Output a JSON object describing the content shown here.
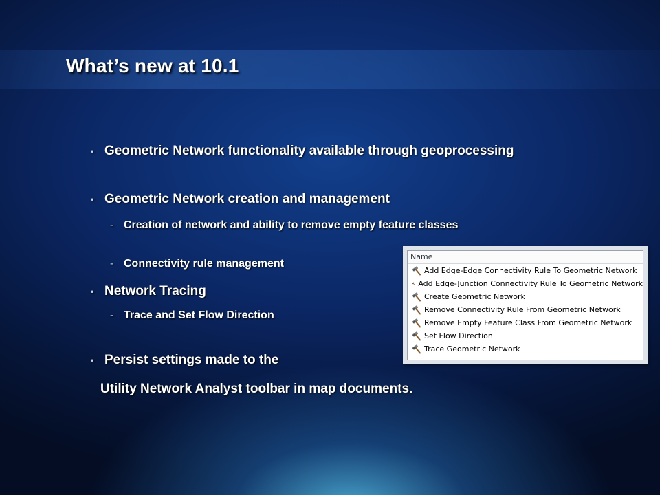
{
  "slide": {
    "title": "What’s new at 10.1",
    "bullets": [
      {
        "text": "Geometric Network functionality available through geoprocessing",
        "level": 1
      },
      {
        "text": "Geometric Network creation and management",
        "level": 1
      },
      {
        "text": "Creation of network and ability to remove empty feature classes",
        "level": 2
      },
      {
        "text": "Connectivity rule management",
        "level": 2
      },
      {
        "text": "Network Tracing",
        "level": 1
      },
      {
        "text": "Trace and Set Flow Direction",
        "level": 2
      },
      {
        "text": "Persist settings made to the",
        "level": 1
      }
    ],
    "continuation": "Utility Network Analyst toolbar in map documents."
  },
  "toolbox": {
    "header": "Name",
    "icon": "hammer-icon",
    "tools": [
      "Add Edge-Edge Connectivity Rule To Geometric Network",
      "Add Edge-Junction Connectivity Rule To Geometric Network",
      "Create Geometric Network",
      "Remove Connectivity Rule From Geometric Network",
      "Remove Empty Feature Class From Geometric Network",
      "Set Flow Direction",
      "Trace Geometric Network"
    ]
  },
  "colors": {
    "background_dark": "#061538",
    "background_glow": "#55beeb",
    "text": "#ffffff"
  }
}
